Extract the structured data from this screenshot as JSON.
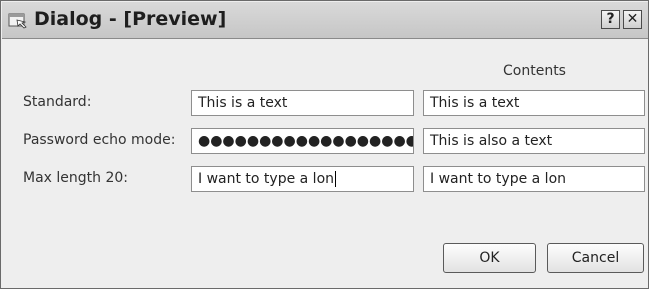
{
  "window": {
    "title": "Dialog - [Preview]",
    "help_glyph": "?",
    "close_glyph": "✕"
  },
  "contents_header": "Contents",
  "rows": [
    {
      "label": "Standard:",
      "input_value": "This is a text",
      "contents_value": "This is a text"
    },
    {
      "label": "Password echo mode:",
      "input_value": "●●●●●●●●●●●●●●●●●●●",
      "contents_value": "This is also a text"
    },
    {
      "label": "Max length 20:",
      "input_value": "I want to type a lon",
      "contents_value": "I want to type a lon"
    }
  ],
  "buttons": {
    "ok": "OK",
    "cancel": "Cancel"
  },
  "icons": {
    "window_icon": "dialog-preview-icon",
    "help": "help-icon",
    "close": "close-icon"
  }
}
